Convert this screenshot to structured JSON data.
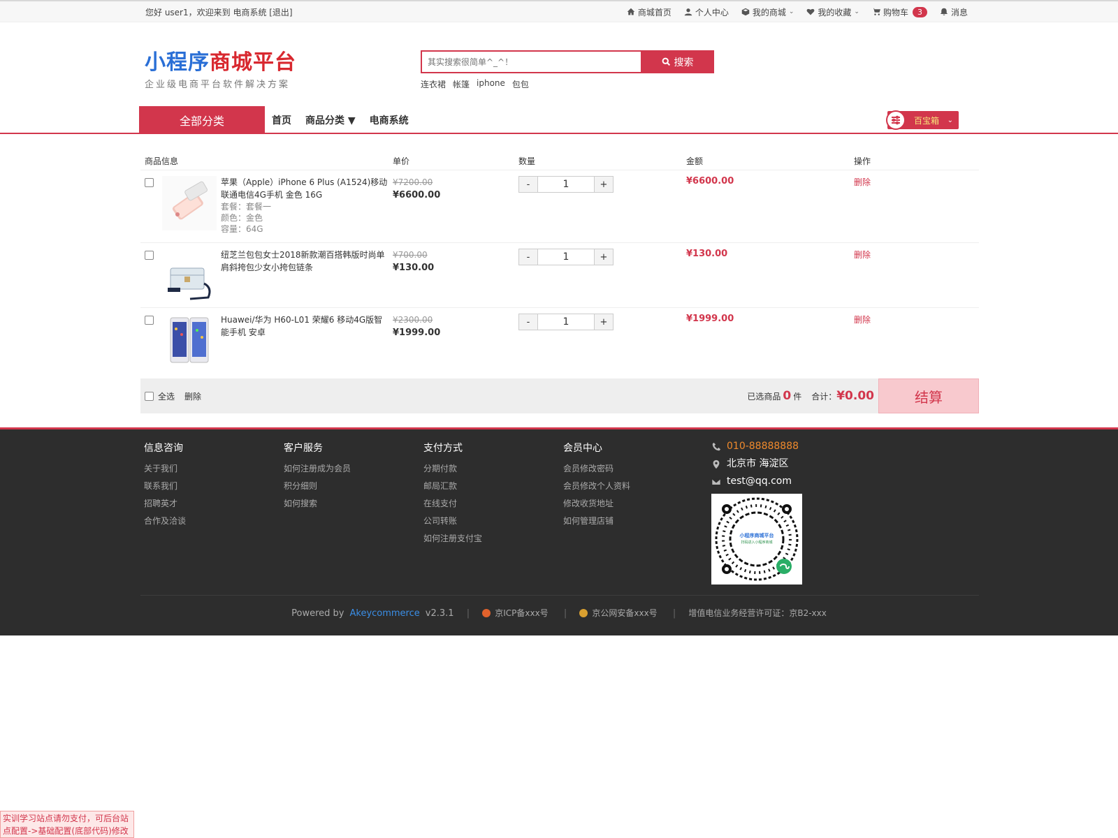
{
  "topbar": {
    "greeting": "您好 user1，欢迎来到 电商系统 [退出]",
    "links": [
      {
        "label": "商城首页",
        "icon": "home-icon"
      },
      {
        "label": "个人中心",
        "icon": "user-icon"
      },
      {
        "label": "我的商城",
        "icon": "cube-icon",
        "dropdown": true
      },
      {
        "label": "我的收藏",
        "icon": "heart-icon",
        "dropdown": true
      },
      {
        "label": "购物车",
        "icon": "cart-icon",
        "badge": "3"
      },
      {
        "label": "消息",
        "icon": "bell-icon"
      }
    ]
  },
  "logo": {
    "title_blue": "小程序",
    "title_red": "商城平台",
    "subtitle": "企业级电商平台软件解决方案"
  },
  "search": {
    "placeholder": "其实搜索很简单^_^！",
    "button": "搜索",
    "hotwords": [
      "连衣裙",
      "帐篷",
      "iphone",
      "包包"
    ]
  },
  "nav": {
    "all_categories": "全部分类",
    "links": [
      "首页",
      "商品分类",
      "电商系统"
    ],
    "treasure": "百宝箱"
  },
  "cart": {
    "headers": [
      "商品信息",
      "单价",
      "数量",
      "金额",
      "操作"
    ],
    "items": [
      {
        "name": "苹果（Apple）iPhone 6 Plus (A1524)移动联通电信4G手机 金色 16G",
        "specs": [
          "套餐：套餐一",
          "颜色：金色",
          "容量：64G"
        ],
        "old_price": "¥7200.00",
        "price": "¥6600.00",
        "qty": "1",
        "amount": "¥6600.00",
        "action": "删除"
      },
      {
        "name": "纽芝兰包包女士2018新款潮百搭韩版时尚单肩斜挎包少女小挎包链条",
        "specs": [],
        "old_price": "¥700.00",
        "price": "¥130.00",
        "qty": "1",
        "amount": "¥130.00",
        "action": "删除"
      },
      {
        "name": "Huawei/华为 H60-L01 荣耀6 移动4G版智能手机 安卓",
        "specs": [],
        "old_price": "¥2300.00",
        "price": "¥1999.00",
        "qty": "1",
        "amount": "¥1999.00",
        "action": "删除"
      }
    ],
    "qty_minus": "-",
    "qty_plus": "+",
    "select_all": "全选",
    "delete": "删除",
    "selected_prefix": "已选商品",
    "selected_count": "0",
    "selected_suffix": "件",
    "total_label": "合计：",
    "total": "¥0.00",
    "checkout": "结算"
  },
  "footer": {
    "columns": [
      {
        "title": "信息咨询",
        "items": [
          "关于我们",
          "联系我们",
          "招聘英才",
          "合作及洽谈"
        ]
      },
      {
        "title": "客户服务",
        "items": [
          "如何注册成为会员",
          "积分细则",
          "如何搜索"
        ]
      },
      {
        "title": "支付方式",
        "items": [
          "分期付款",
          "邮局汇款",
          "在线支付",
          "公司转账",
          "如何注册支付宝"
        ]
      },
      {
        "title": "会员中心",
        "items": [
          "会员修改密码",
          "会员修改个人资料",
          "修改收货地址",
          "如何管理店铺"
        ]
      }
    ],
    "phone": "010-88888888",
    "address": "北京市 海淀区",
    "email": "test@qq.com",
    "qr_title": "小程序商城平台",
    "qr_sub": "扫码进入小程序商城",
    "powered_prefix": "Powered by",
    "powered_name": "Akeycommerce",
    "version": "v2.3.1",
    "icp": "京ICP备xxx号",
    "police": "京公网安备xxx号",
    "license": "增值电信业务经营许可证：京B2-xxx"
  },
  "notice": "实训学习站点请勿支付，可后台站点配置->基础配置(底部代码)修改",
  "colors": {
    "accent": "#d2364c",
    "footer_bg": "#2d2d2d",
    "phone": "#f08a2c",
    "link": "#3a8ee6"
  }
}
